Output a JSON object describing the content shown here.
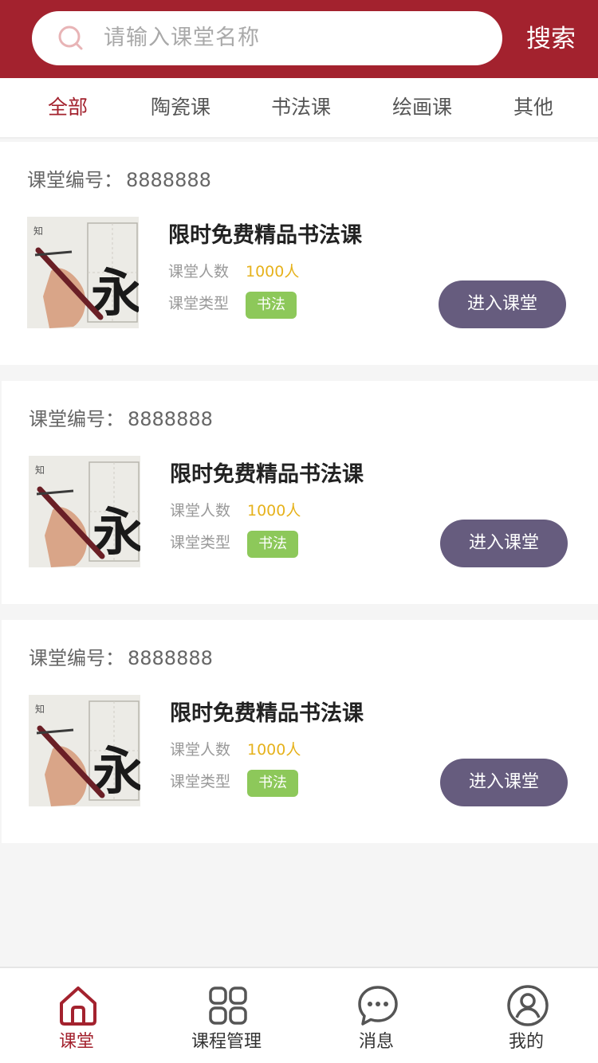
{
  "search": {
    "placeholder": "请输入课堂名称",
    "button_label": "搜索",
    "icon": "search-icon"
  },
  "tabs": [
    {
      "label": "全部",
      "active": true
    },
    {
      "label": "陶瓷课",
      "active": false
    },
    {
      "label": "书法课",
      "active": false
    },
    {
      "label": "绘画课",
      "active": false
    },
    {
      "label": "其他",
      "active": false
    }
  ],
  "classes": [
    {
      "code_label": "课堂编号：",
      "code": "8888888",
      "title": "限时免费精品书法课",
      "count_label": "课堂人数",
      "count": "1000人",
      "type_label": "课堂类型",
      "type": "书法",
      "enter_label": "进入课堂"
    },
    {
      "code_label": "课堂编号：",
      "code": "8888888",
      "title": "限时免费精品书法课",
      "count_label": "课堂人数",
      "count": "1000人",
      "type_label": "课堂类型",
      "type": "书法",
      "enter_label": "进入课堂"
    },
    {
      "code_label": "课堂编号：",
      "code": "8888888",
      "title": "限时免费精品书法课",
      "count_label": "课堂人数",
      "count": "1000人",
      "type_label": "课堂类型",
      "type": "书法",
      "enter_label": "进入课堂"
    }
  ],
  "bottom_nav": [
    {
      "label": "课堂",
      "icon": "home-icon",
      "active": true
    },
    {
      "label": "课程管理",
      "icon": "grid-icon",
      "active": false
    },
    {
      "label": "消息",
      "icon": "chat-bubble-icon",
      "active": false
    },
    {
      "label": "我的",
      "icon": "user-icon",
      "active": false
    }
  ],
  "colors": {
    "brand": "#a3222e",
    "button": "#665c7e",
    "tag": "#8dc85a",
    "count": "#e6b21c"
  }
}
